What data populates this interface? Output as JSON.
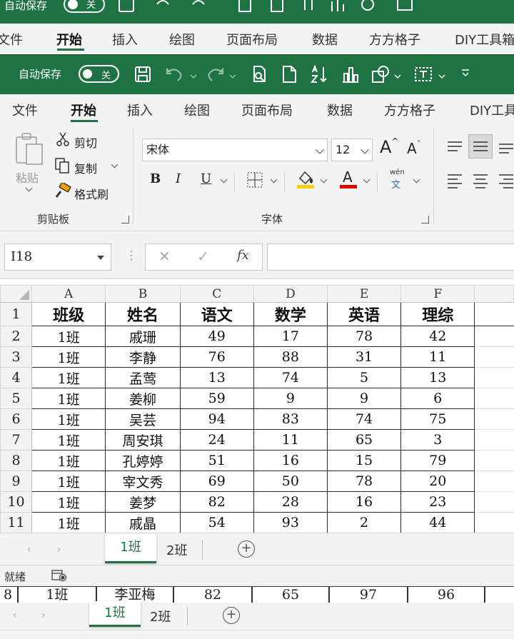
{
  "background_window": {
    "autosave_label": "自动保存",
    "autosave_state": "关",
    "tabs": [
      "文件",
      "开始",
      "插入",
      "绘图",
      "页面布局",
      "数据",
      "方方格子",
      "DIY工具箱"
    ],
    "active_tab": "开始",
    "partial_row": [
      "8",
      "1班",
      "李亚梅",
      "82",
      "65",
      "97",
      "96"
    ],
    "sheet_tabs": [
      "1班",
      "2班"
    ],
    "status_partial": "就绪"
  },
  "titlebar": {
    "autosave_label": "自动保存",
    "autosave_state": "关"
  },
  "ribbon_tabs": [
    "文件",
    "开始",
    "插入",
    "绘图",
    "页面布局",
    "数据",
    "方方格子",
    "DIY工具箱"
  ],
  "active_tab": "开始",
  "clipboard": {
    "paste_label": "粘贴",
    "cut_label": "剪切",
    "copy_label": "复制",
    "format_painter_label": "格式刷",
    "group_label": "剪贴板"
  },
  "font": {
    "font_name": "宋体",
    "font_size": "12",
    "bold": "B",
    "italic": "I",
    "underline": "U",
    "grow": "A",
    "shrink": "A",
    "font_color_letter": "A",
    "phonetic_top": "wén",
    "phonetic_bottom": "文",
    "group_label": "字体"
  },
  "formula_bar": {
    "name_box": "I18",
    "fx": "fx",
    "formula": ""
  },
  "grid": {
    "columns": [
      "A",
      "B",
      "C",
      "D",
      "E",
      "F"
    ],
    "rows": [
      {
        "num": "1",
        "cells": [
          "班级",
          "姓名",
          "语文",
          "数学",
          "英语",
          "理综"
        ]
      },
      {
        "num": "2",
        "cells": [
          "1班",
          "戚珊",
          "49",
          "17",
          "78",
          "42"
        ]
      },
      {
        "num": "3",
        "cells": [
          "1班",
          "李静",
          "76",
          "88",
          "31",
          "11"
        ]
      },
      {
        "num": "4",
        "cells": [
          "1班",
          "孟莺",
          "13",
          "74",
          "5",
          "13"
        ]
      },
      {
        "num": "5",
        "cells": [
          "1班",
          "姜柳",
          "59",
          "9",
          "9",
          "6"
        ]
      },
      {
        "num": "6",
        "cells": [
          "1班",
          "吴芸",
          "94",
          "83",
          "74",
          "75"
        ]
      },
      {
        "num": "7",
        "cells": [
          "1班",
          "周安琪",
          "24",
          "11",
          "65",
          "3"
        ]
      },
      {
        "num": "8",
        "cells": [
          "1班",
          "孔婷婷",
          "51",
          "16",
          "15",
          "79"
        ]
      },
      {
        "num": "9",
        "cells": [
          "1班",
          "宰文秀",
          "69",
          "50",
          "78",
          "20"
        ]
      },
      {
        "num": "10",
        "cells": [
          "1班",
          "姜梦",
          "82",
          "28",
          "16",
          "23"
        ]
      },
      {
        "num": "11",
        "cells": [
          "1班",
          "戚晶",
          "54",
          "93",
          "2",
          "44"
        ]
      }
    ]
  },
  "sheet_tabs": [
    "1班",
    "2班"
  ],
  "active_sheet": "1班",
  "status": {
    "ready": "就绪"
  },
  "colors": {
    "excel_green": "#1f7244",
    "ribbon_bg": "#f3f3f3",
    "font_highlight": "#f5d000",
    "font_color": "#e00000"
  }
}
